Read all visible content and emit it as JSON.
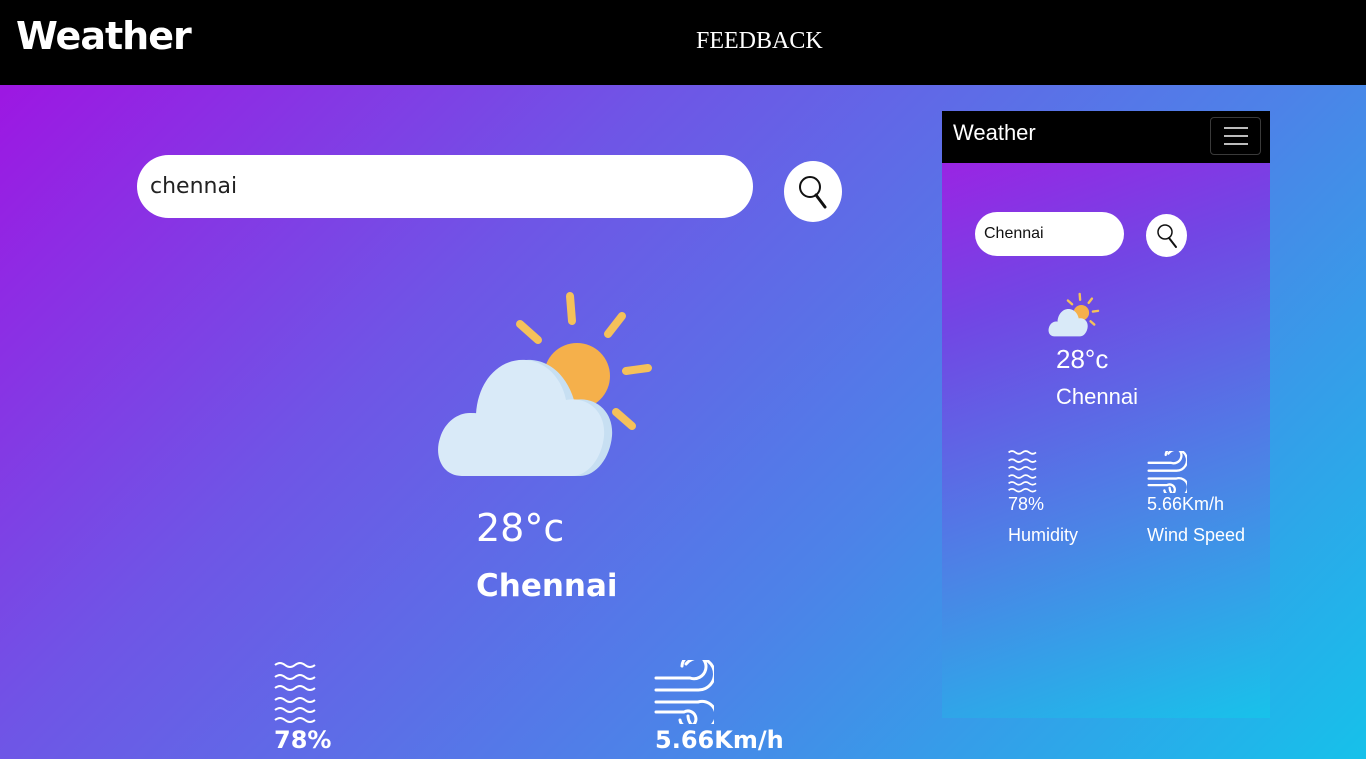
{
  "header": {
    "brand": "Weather",
    "feedback_link": "FEEDBACK"
  },
  "search": {
    "value": "chennai",
    "button_icon": "search-icon"
  },
  "current": {
    "icon": "partly-cloudy-icon",
    "temperature": "28°c",
    "city": "Chennai"
  },
  "details": {
    "humidity": {
      "icon": "humidity-waves-icon",
      "value": "78%"
    },
    "wind": {
      "icon": "wind-icon",
      "value": "5.66Km/h"
    }
  },
  "mobile_preview": {
    "brand": "Weather",
    "menu_icon": "hamburger-menu-icon",
    "search_value": "Chennai",
    "temperature": "28°c",
    "city": "Chennai",
    "humidity_value": "78%",
    "humidity_label": "Humidity",
    "wind_value": "5.66Km/h",
    "wind_label": "Wind Speed"
  },
  "colors": {
    "header_bg": "#000000",
    "gradient_start": "#a30fe2",
    "gradient_end": "#16c1ea",
    "sun": "#f5b04b",
    "cloud": "#d7e9f8"
  }
}
